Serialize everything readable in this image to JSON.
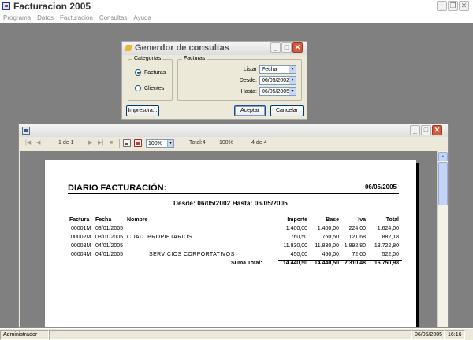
{
  "app": {
    "title": "Facturacion 2005",
    "menu": [
      "Programa",
      "Datos",
      "Facturación",
      "Consultas",
      "Ayuda"
    ]
  },
  "status": {
    "user": "Administrador",
    "date": "06/05/2005",
    "time": "16:16"
  },
  "dialog": {
    "title": "Generdor de consultas",
    "categorias_label": "Categorías",
    "categorias": [
      {
        "label": "Facturas",
        "selected": true
      },
      {
        "label": "Clientes",
        "selected": false
      }
    ],
    "facturas_label": "Facturas",
    "listar_label": "Listar",
    "listar_value": "Fecha",
    "desde_label": "Desde:",
    "desde_value": "06/05/2002",
    "hasta_label": "Hasta:",
    "hasta_value": "06/05/2005",
    "printer_button": "Impresora...",
    "accept_button": "Aceptar",
    "cancel_button": "Cancelar"
  },
  "report_window": {
    "toolbar": {
      "page_indicator": "1 de 1",
      "zoom": "100%",
      "total": "Total:4",
      "percent": "100%",
      "count": "4 de 4"
    }
  },
  "report": {
    "title": "DIARIO FACTURACIÓN:",
    "date": "06/05/2005",
    "range": "Desde: 06/05/2002 Hasta: 06/05/2005",
    "headers": {
      "factura": "Factura",
      "fecha": "Fecha",
      "nombre": "Nombre",
      "importe": "Importe",
      "base": "Base",
      "iva": "Iva",
      "total": "Total"
    },
    "rows": [
      {
        "factura": "00001M",
        "fecha": "03/01/2005",
        "nombre": "",
        "importe": "1.400,00",
        "base": "1.400,00",
        "iva": "224,00",
        "total": "1.624,00"
      },
      {
        "factura": "00002M",
        "fecha": "03/01/2005",
        "nombre": "CDAD. PROPIETARIOS",
        "importe": "760,50",
        "base": "760,50",
        "iva": "121,68",
        "total": "882,18"
      },
      {
        "factura": "00003M",
        "fecha": "04/01/2005",
        "nombre": "",
        "importe": "11.830,00",
        "base": "11.830,00",
        "iva": "1.892,80",
        "total": "13.722,80"
      },
      {
        "factura": "00004M",
        "fecha": "04/01/2005",
        "nombre": "SERVICIOS CORPORTATIVOS",
        "importe": "450,00",
        "base": "450,00",
        "iva": "72,00",
        "total": "522,00"
      }
    ],
    "sum_label": "Suma Total:",
    "sum_importe": "14.440,50",
    "sum_base": "14.440,50",
    "sum_iva": "2.310,48",
    "sum_total": "16.750,98"
  }
}
